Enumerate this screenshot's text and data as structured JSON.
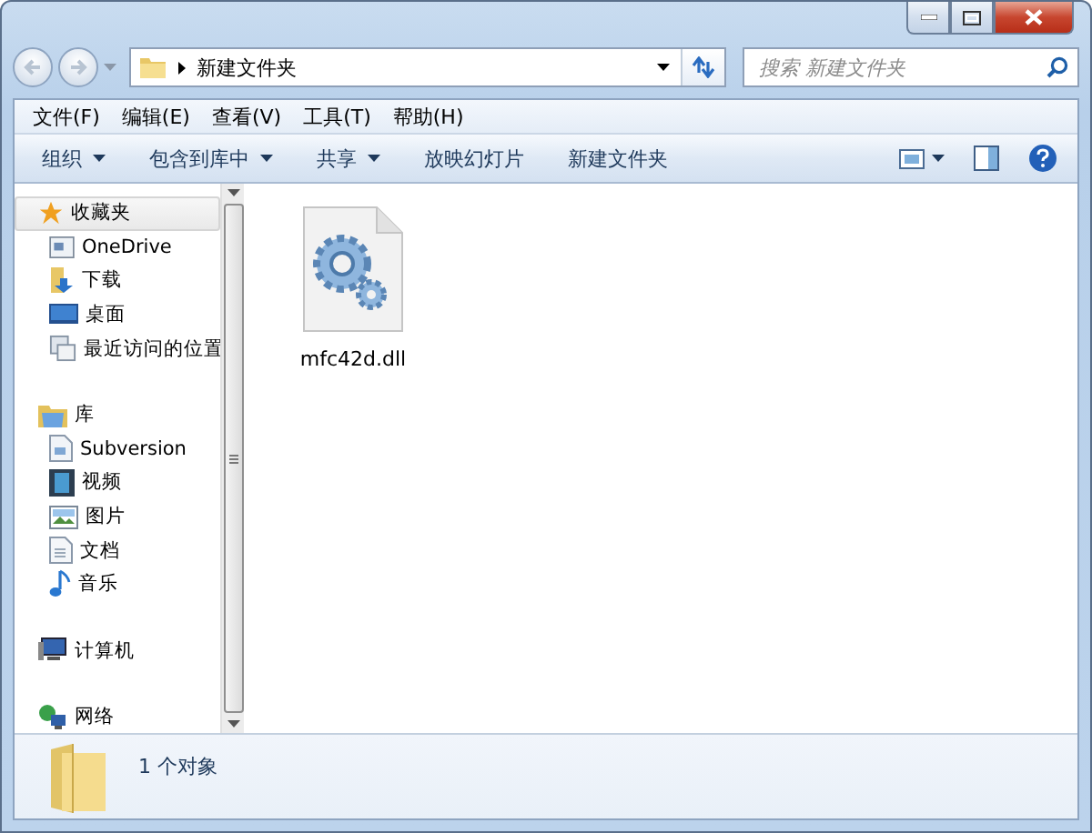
{
  "address_bar": {
    "path": "新建文件夹"
  },
  "search": {
    "placeholder": "搜索 新建文件夹"
  },
  "menu_bar": [
    "文件(F)",
    "编辑(E)",
    "查看(V)",
    "工具(T)",
    "帮助(H)"
  ],
  "command_bar": [
    {
      "label": "组织",
      "dropdown": true
    },
    {
      "label": "包含到库中",
      "dropdown": true
    },
    {
      "label": "共享",
      "dropdown": true
    },
    {
      "label": "放映幻灯片",
      "dropdown": false
    },
    {
      "label": "新建文件夹",
      "dropdown": false
    }
  ],
  "nav_pane": [
    {
      "label": "收藏夹",
      "selected": true,
      "children": [
        {
          "label": "OneDrive",
          "selected": false
        },
        {
          "label": "下载",
          "selected": false
        },
        {
          "label": "桌面",
          "selected": false
        },
        {
          "label": "最近访问的位置",
          "selected": false
        }
      ]
    },
    {
      "label": "库",
      "selected": false,
      "children": [
        {
          "label": "Subversion",
          "selected": false
        },
        {
          "label": "视频",
          "selected": false
        },
        {
          "label": "图片",
          "selected": false
        },
        {
          "label": "文档",
          "selected": false
        },
        {
          "label": "音乐",
          "selected": false
        }
      ]
    },
    {
      "label": "计算机",
      "selected": false
    },
    {
      "label": "网络",
      "selected": false
    }
  ],
  "files": [
    {
      "name": "mfc42d.dll",
      "selected": false
    }
  ],
  "details_pane": {
    "summary": "1 个对象"
  }
}
